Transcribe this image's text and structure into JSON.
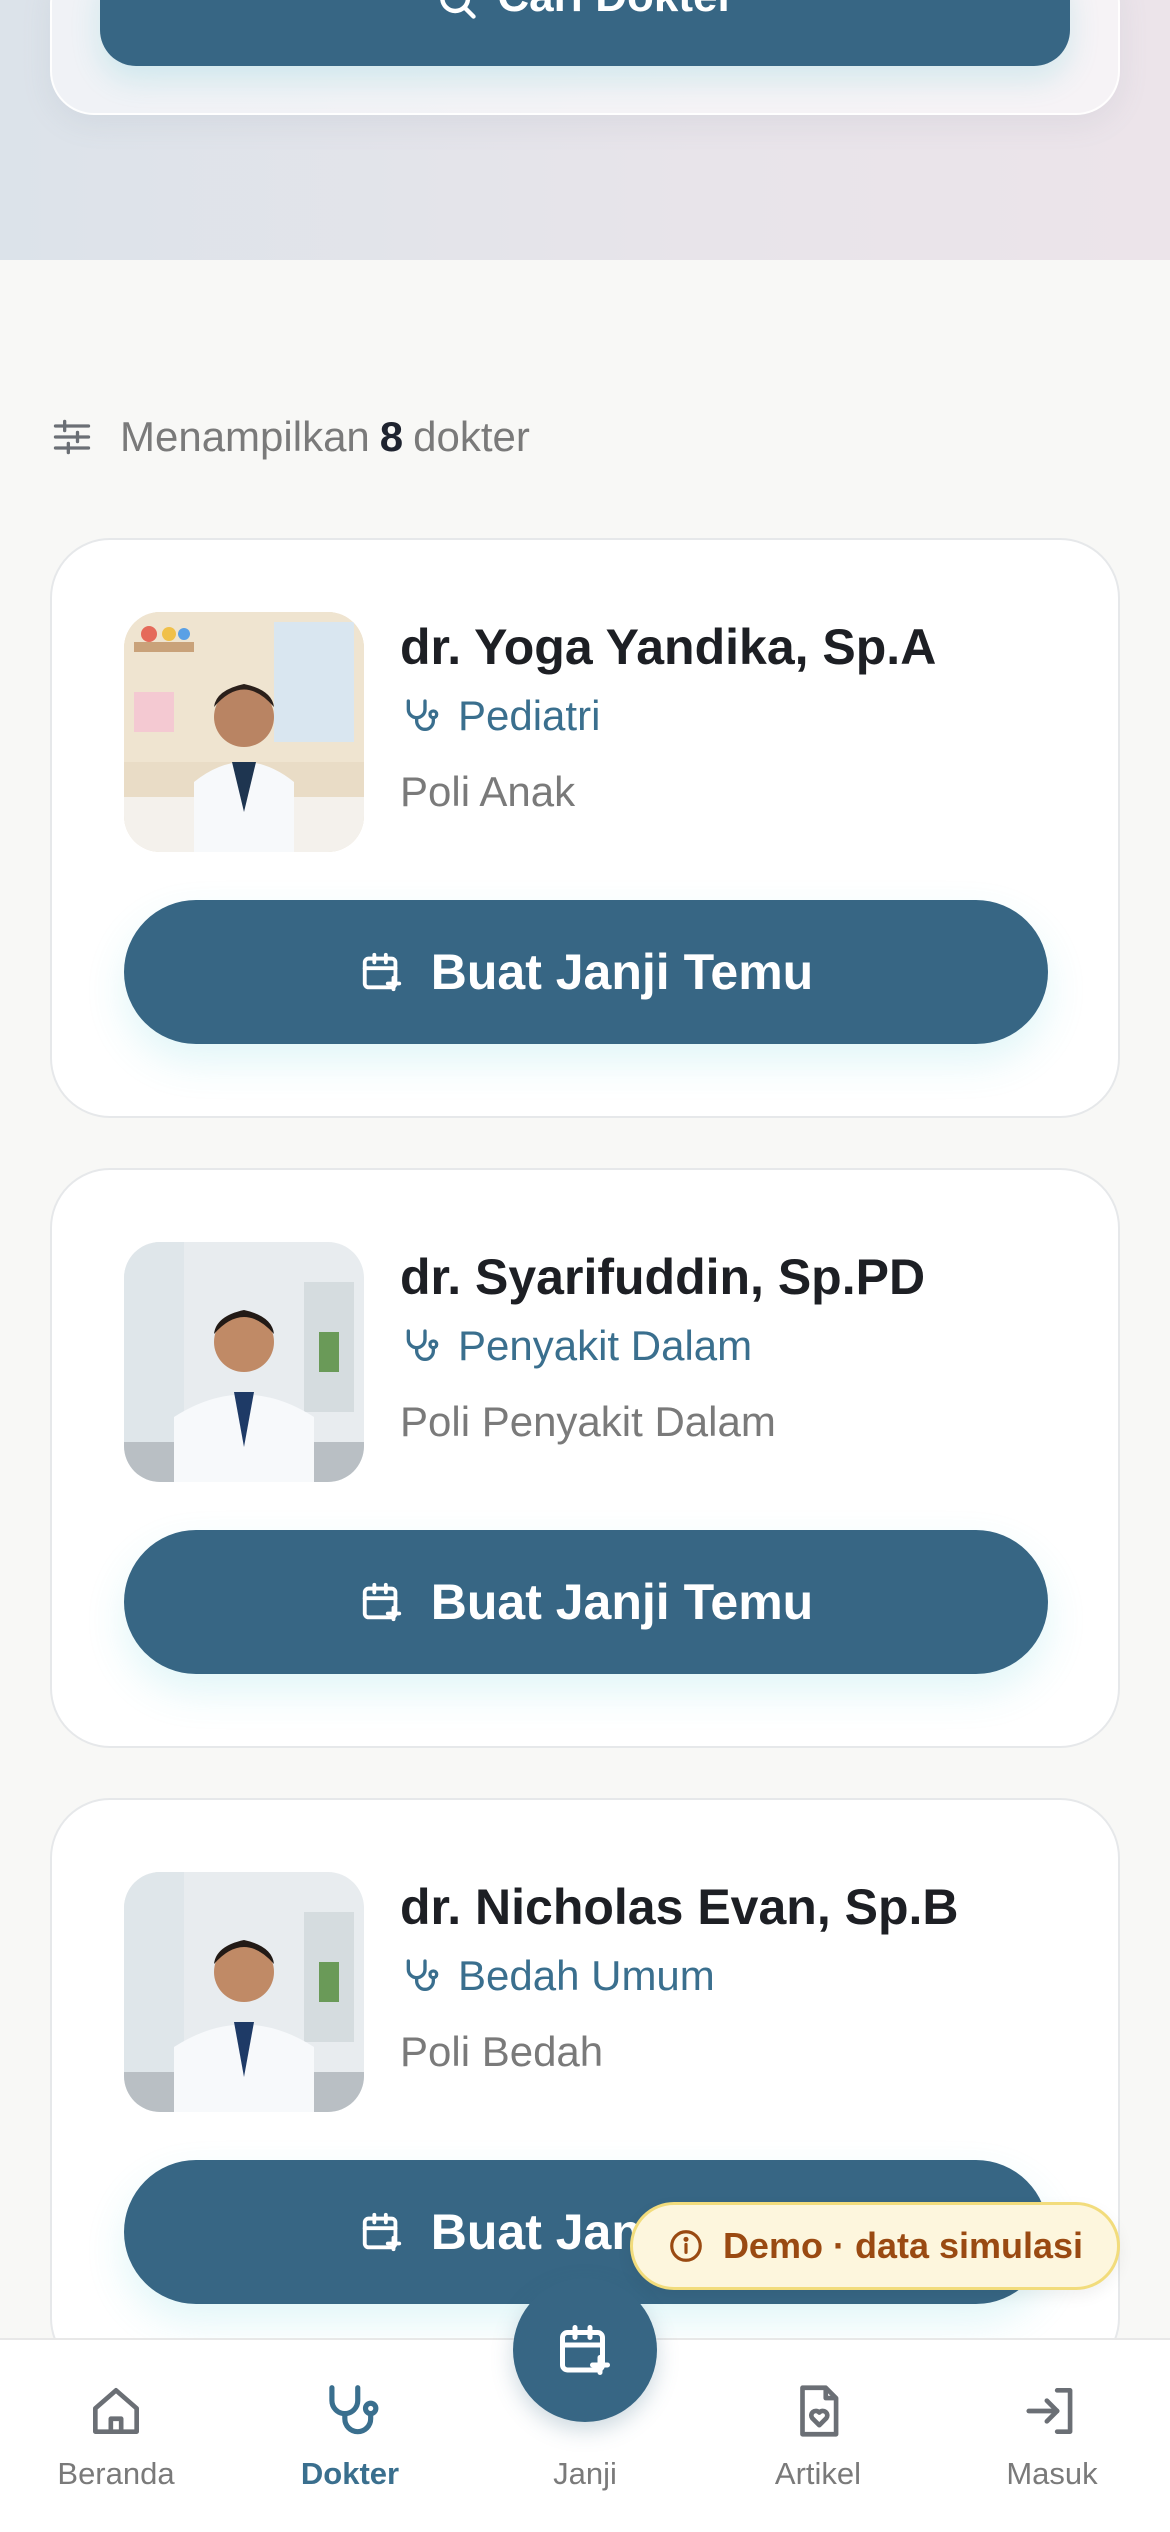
{
  "search": {
    "button_label": "Cari Dokter"
  },
  "results": {
    "prefix": "Menampilkan",
    "count": "8",
    "suffix": "dokter"
  },
  "doctors": [
    {
      "name": "dr. Yoga Yandika, Sp.A",
      "specialty": "Pediatri",
      "clinic": "Poli Anak",
      "button_label": "Buat Janji Temu"
    },
    {
      "name": "dr. Syarifuddin, Sp.PD",
      "specialty": "Penyakit Dalam",
      "clinic": "Poli Penyakit Dalam",
      "button_label": "Buat Janji Temu"
    },
    {
      "name": "dr. Nicholas Evan, Sp.B",
      "specialty": "Bedah Umum",
      "clinic": "Poli Bedah",
      "button_label": "Buat Janji Temu"
    }
  ],
  "demo_badge": {
    "label": "Demo · data simulasi"
  },
  "nav": {
    "items": [
      {
        "label": "Beranda",
        "icon": "home-icon"
      },
      {
        "label": "Dokter",
        "icon": "stethoscope-icon"
      },
      {
        "label": "Janji",
        "icon": "calendar-plus-icon"
      },
      {
        "label": "Artikel",
        "icon": "article-icon"
      },
      {
        "label": "Masuk",
        "icon": "login-icon"
      }
    ],
    "active": "Dokter"
  },
  "colors": {
    "primary": "#376684",
    "accent_text": "#3a6f8e",
    "muted_text": "#7a7a7a",
    "badge_bg": "#fdf6dd",
    "badge_border": "#f2dc7c",
    "badge_text": "#9a4a12"
  }
}
